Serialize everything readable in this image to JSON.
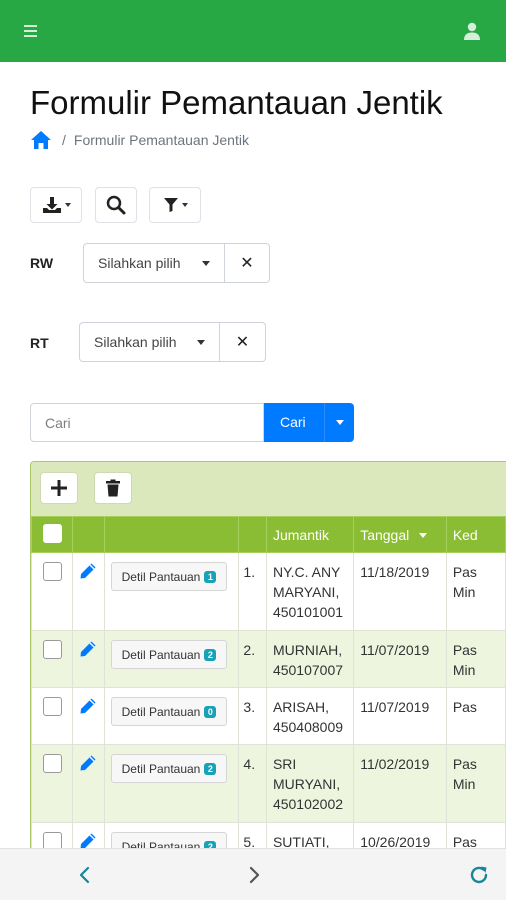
{
  "header": {
    "menu_icon": "hamburger-icon",
    "user_icon": "user-icon",
    "color": "#28a745"
  },
  "page": {
    "title": "Formulir Pemantauan Jentik"
  },
  "breadcrumb": {
    "home_icon": "home-icon",
    "separator": "/",
    "current": "Formulir Pemantauan Jentik"
  },
  "toolbar": {
    "export_icon": "download-icon",
    "search_icon": "search-icon",
    "filter_icon": "filter-icon"
  },
  "filters": {
    "rw": {
      "label": "RW",
      "value": "Silahkan pilih",
      "clear": "✕"
    },
    "rt": {
      "label": "RT",
      "value": "Silahkan pilih",
      "clear": "✕"
    }
  },
  "search": {
    "placeholder": "Cari",
    "button_label": "Cari"
  },
  "grid": {
    "add_icon": "plus-icon",
    "delete_icon": "trash-icon",
    "columns": [
      "",
      "",
      "",
      "",
      "Jumantik",
      "Tanggal",
      "Ked"
    ],
    "rows": [
      {
        "no": "1.",
        "detail_label": "Detil Pantauan",
        "badge": "1",
        "jumantik": "NY.C. ANY MARYANI, 450101001",
        "tanggal": "11/18/2019",
        "ked": "Pas Min"
      },
      {
        "no": "2.",
        "detail_label": "Detil Pantauan",
        "badge": "2",
        "jumantik": "MURNIAH, 450107007",
        "tanggal": "11/07/2019",
        "ked": "Pas Min"
      },
      {
        "no": "3.",
        "detail_label": "Detil Pantauan",
        "badge": "0",
        "jumantik": "ARISAH, 450408009",
        "tanggal": "11/07/2019",
        "ked": "Pas"
      },
      {
        "no": "4.",
        "detail_label": "Detil Pantauan",
        "badge": "2",
        "jumantik": "SRI MURYANI, 450102002",
        "tanggal": "11/02/2019",
        "ked": "Pas Min"
      },
      {
        "no": "5.",
        "detail_label": "Detil Pantauan",
        "badge": "2",
        "jumantik": "SUTIATI,",
        "tanggal": "10/26/2019",
        "ked": "Pas"
      }
    ]
  },
  "bottom_nav": {
    "back_icon": "chevron-left-icon",
    "forward_icon": "chevron-right-icon",
    "reload_icon": "reload-icon"
  }
}
